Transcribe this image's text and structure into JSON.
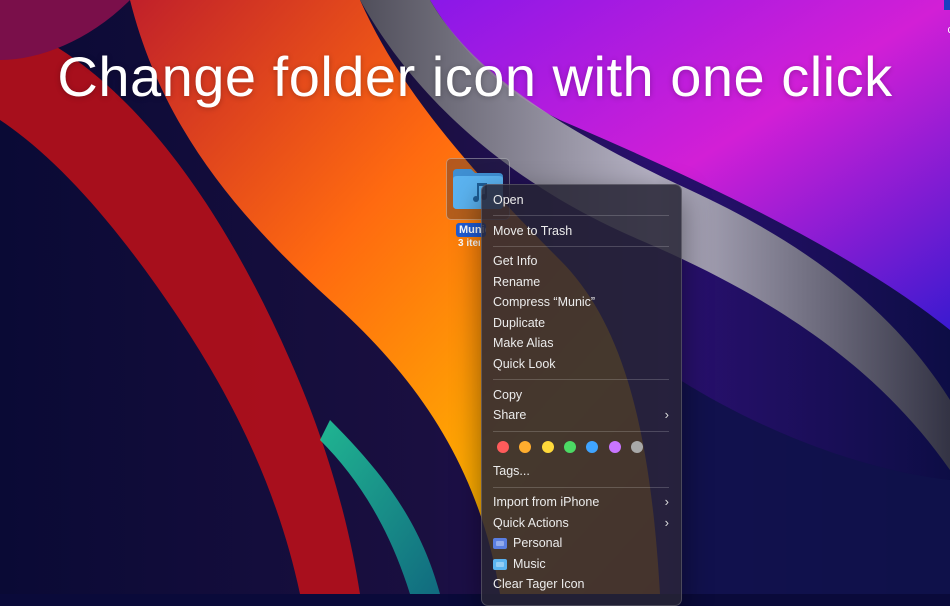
{
  "headline": "Change folder icon with one click",
  "folder": {
    "label": "Munic",
    "count": "3 items"
  },
  "menu": {
    "open": "Open",
    "move_to_trash": "Move to Trash",
    "get_info": "Get Info",
    "rename": "Rename",
    "compress": "Compress “Munic”",
    "duplicate": "Duplicate",
    "make_alias": "Make Alias",
    "quick_look": "Quick Look",
    "copy": "Copy",
    "share": "Share",
    "tags": "Tags...",
    "import_from_iphone": "Import from iPhone",
    "quick_actions": "Quick Actions",
    "personal": "Personal",
    "music": "Music",
    "clear_icon": "Clear Tager Icon",
    "submenu_chevron": "›",
    "tag_colors": [
      "#ff5b5b",
      "#ffad2e",
      "#ffd93a",
      "#4cd964",
      "#3fa4ff",
      "#c875ff",
      "#a8a8a8"
    ]
  },
  "corner_glyph": "c",
  "colors": {
    "selection_blue": "#1f5cd6",
    "folder_blue": "#5bb3f0",
    "menu_bg": "#262434"
  }
}
